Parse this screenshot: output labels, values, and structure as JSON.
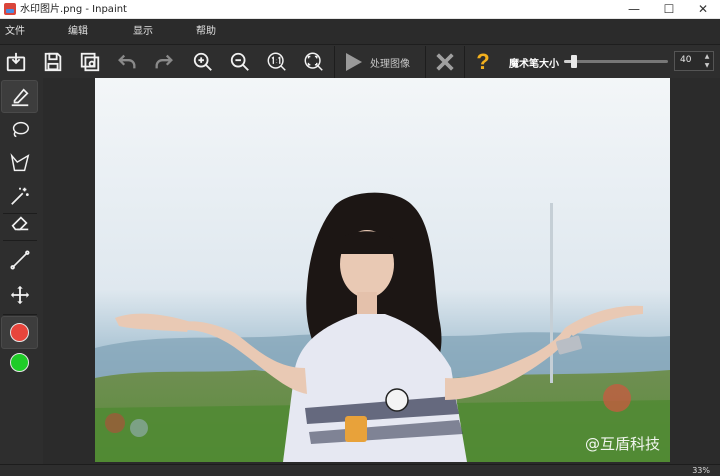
{
  "window": {
    "title": "水印图片.png - Inpaint",
    "minimize": "—",
    "maximize": "☐",
    "close": "✕"
  },
  "menu": [
    {
      "label": "文件"
    },
    {
      "label": "编辑"
    },
    {
      "label": "显示"
    },
    {
      "label": "帮助"
    }
  ],
  "toolbar": {
    "process_label": "处理图像",
    "brush_size_label": "魔术笔大小",
    "brush_size_value": "40",
    "brush_size_fraction": 0.1,
    "spin_up": "▲",
    "spin_down": "▼",
    "icons": [
      "open-icon",
      "save-icon",
      "save-as-icon",
      "undo-icon",
      "redo-icon",
      "zoom-in-icon",
      "zoom-out-icon",
      "actual-size-icon",
      "fit-window-icon",
      "play-icon",
      "cancel-icon",
      "help-icon"
    ],
    "help_glyph": "?"
  },
  "tools": {
    "icons": [
      "marker-icon",
      "lasso-icon",
      "polygonal-lasso-icon",
      "magic-wand-icon",
      "eraser-icon",
      "line-icon",
      "move-icon"
    ],
    "colors": {
      "primary": "#e8453c",
      "secondary": "#1fcc28"
    }
  },
  "image": {
    "watermark_text": "@互盾科技"
  },
  "status": {
    "zoom": "33%"
  }
}
